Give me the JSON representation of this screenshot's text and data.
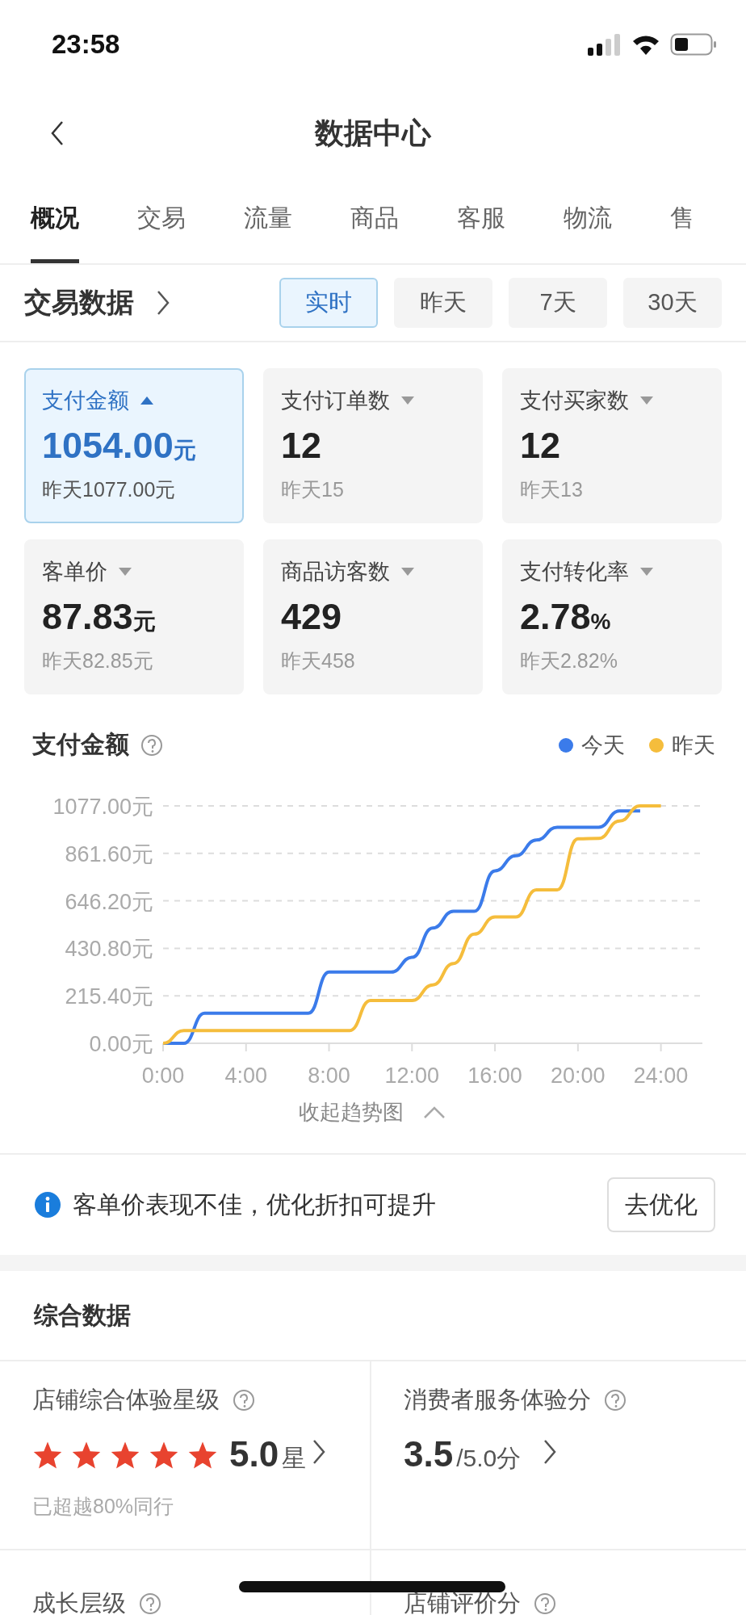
{
  "status_bar": {
    "time": "23:58"
  },
  "nav": {
    "title": "数据中心"
  },
  "tabs": [
    {
      "label": "概况",
      "selected": true
    },
    {
      "label": "交易",
      "selected": false
    },
    {
      "label": "流量",
      "selected": false
    },
    {
      "label": "商品",
      "selected": false
    },
    {
      "label": "客服",
      "selected": false
    },
    {
      "label": "物流",
      "selected": false
    },
    {
      "label": "售",
      "selected": false
    }
  ],
  "section": {
    "title": "交易数据",
    "periods": [
      {
        "label": "实时",
        "selected": true
      },
      {
        "label": "昨天",
        "selected": false
      },
      {
        "label": "7天",
        "selected": false
      },
      {
        "label": "30天",
        "selected": false
      }
    ]
  },
  "metrics": [
    {
      "label": "支付金额",
      "value": "1054.00",
      "unit": "元",
      "compare": "昨天1077.00元",
      "selected": true
    },
    {
      "label": "支付订单数",
      "value": "12",
      "compare": "昨天15",
      "selected": false
    },
    {
      "label": "支付买家数",
      "value": "12",
      "compare": "昨天13",
      "selected": false
    },
    {
      "label": "客单价",
      "value": "87.83",
      "unit": "元",
      "compare": "昨天82.85元",
      "selected": false
    },
    {
      "label": "商品访客数",
      "value": "429",
      "compare": "昨天458",
      "selected": false
    },
    {
      "label": "支付转化率",
      "value": "2.78",
      "unit": "%",
      "compare": "昨天2.82%",
      "selected": false
    }
  ],
  "chart": {
    "title": "支付金额",
    "chart_data": {
      "type": "line",
      "x": [
        0,
        1,
        2,
        3,
        4,
        5,
        6,
        7,
        8,
        9,
        10,
        11,
        12,
        13,
        14,
        15,
        16,
        17,
        18,
        19,
        20,
        21,
        22,
        23,
        24
      ],
      "series": [
        {
          "name": "今天",
          "color": "#3b7bea",
          "values": [
            0,
            0,
            136,
            136,
            136,
            136,
            136,
            136,
            323,
            323,
            323,
            323,
            390,
            523,
            599,
            599,
            782,
            851,
            922,
            980,
            980,
            980,
            1054,
            1054,
            null
          ]
        },
        {
          "name": "昨天",
          "color": "#f5bd3c",
          "values": [
            0,
            58,
            58,
            58,
            58,
            58,
            58,
            58,
            58,
            58,
            194,
            194,
            194,
            265,
            362,
            495,
            573,
            573,
            696,
            696,
            928,
            930,
            1008,
            1077,
            1077
          ]
        }
      ],
      "xlim": [
        0,
        26
      ],
      "ylim": [
        0,
        1077
      ],
      "grid": true,
      "xticks": [
        {
          "value": 0,
          "label": "0:00"
        },
        {
          "value": 4,
          "label": "4:00"
        },
        {
          "value": 8,
          "label": "8:00"
        },
        {
          "value": 12,
          "label": "12:00"
        },
        {
          "value": 16,
          "label": "16:00"
        },
        {
          "value": 20,
          "label": "20:00"
        },
        {
          "value": 24,
          "label": "24:00"
        }
      ],
      "yticks": [
        {
          "value": 0,
          "label": "0.00元"
        },
        {
          "value": 215.4,
          "label": "215.40元"
        },
        {
          "value": 430.8,
          "label": "430.80元"
        },
        {
          "value": 646.2,
          "label": "646.20元"
        },
        {
          "value": 861.6,
          "label": "861.60元"
        },
        {
          "value": 1077,
          "label": "1077.00元"
        }
      ]
    },
    "collapse_label": "收起趋势图"
  },
  "tip": {
    "text": "客单价表现不佳，优化折扣可提升",
    "action": "去优化"
  },
  "summary": {
    "title": "综合数据",
    "items": [
      {
        "kind": "stars",
        "label": "店铺综合体验星级",
        "stars": 5,
        "score": "5.0",
        "unit": "星",
        "note": "已超越80%同行"
      },
      {
        "kind": "score",
        "label": "消费者服务体验分",
        "score": "3.5",
        "unit": "/5.0分"
      },
      {
        "kind": "cut",
        "label": "成长层级"
      },
      {
        "kind": "cut",
        "label": "店铺评价分"
      }
    ]
  }
}
